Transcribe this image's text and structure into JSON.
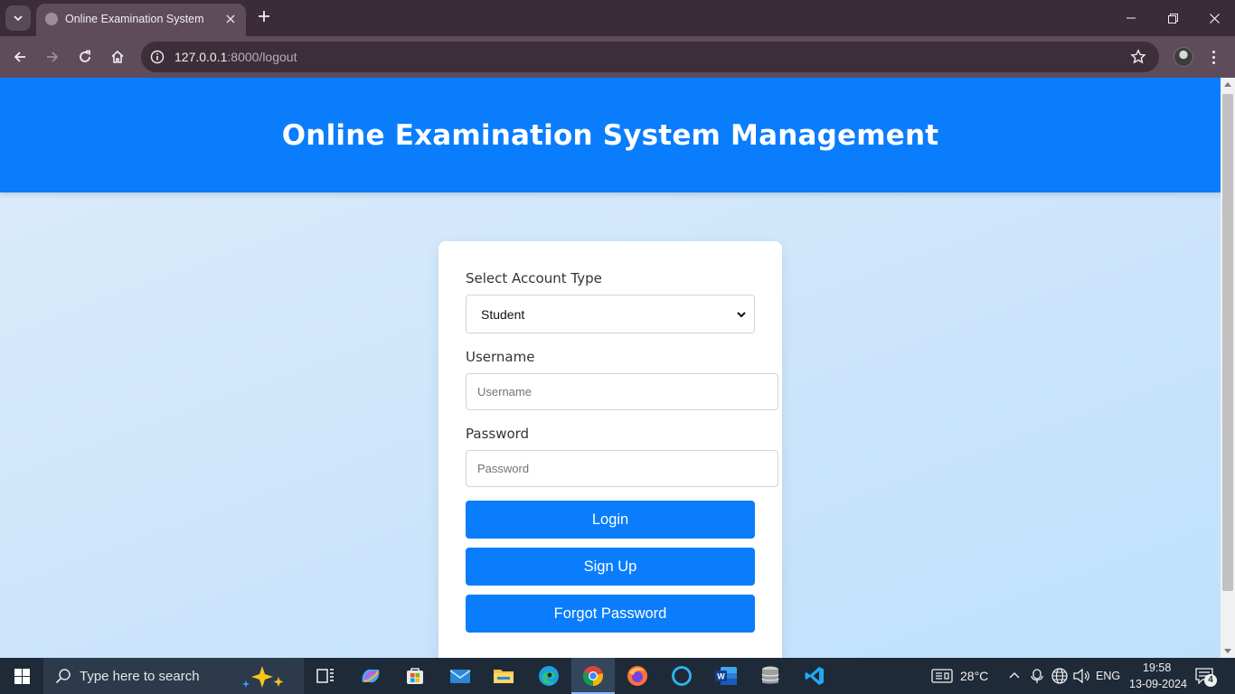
{
  "browser": {
    "tab_title": "Online Examination System",
    "url_host": "127.0.0.1",
    "url_path": ":8000/logout"
  },
  "page": {
    "header_title": "Online Examination System Management",
    "form": {
      "account_type_label": "Select Account Type",
      "account_type_value": "Student",
      "username_label": "Username",
      "username_placeholder": "Username",
      "password_label": "Password",
      "password_placeholder": "Password",
      "login_label": "Login",
      "signup_label": "Sign Up",
      "forgot_label": "Forgot Password"
    },
    "colors": {
      "brand": "#0a7dfc"
    }
  },
  "taskbar": {
    "search_placeholder": "Type here to search",
    "weather": "28°C",
    "language": "ENG",
    "time": "19:58",
    "date": "13-09-2024",
    "notification_count": "4",
    "pinned_apps": [
      "task-view",
      "copilot",
      "microsoft-store",
      "mail",
      "file-explorer",
      "edge",
      "chrome",
      "firefox",
      "cortana",
      "word",
      "database",
      "vscode"
    ]
  }
}
